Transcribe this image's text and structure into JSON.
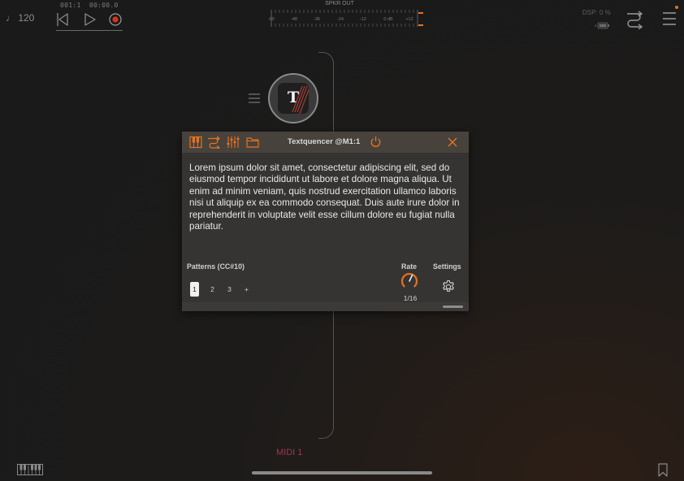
{
  "topbar": {
    "tempo": "♩ 120",
    "position": "001:1",
    "time": "00:00.0",
    "meter_title": "SPKR OUT",
    "meter_scale": [
      "-60",
      "-48",
      "-36",
      "-24",
      "-12",
      "0 dB",
      "+12"
    ],
    "dsp": "DSP: 0 %"
  },
  "chain": {
    "node_letter": "T",
    "midi_label": "MIDI 1"
  },
  "plugin": {
    "title": "Textquencer @M1:1",
    "text": "Lorem ipsum dolor sit amet, consectetur adipiscing elit, sed do eiusmod tempor incididunt ut labore et dolore magna aliqua. Ut enim ad minim veniam, quis nostrud exercitation ullamco laboris nisi ut aliquip ex ea commodo consequat. Duis aute irure dolor in reprehenderit in voluptate velit esse cillum dolore eu fugiat nulla pariatur.",
    "patterns_label": "Patterns (CC#10)",
    "patterns": [
      "1",
      "2",
      "3",
      "+"
    ],
    "selected_pattern": "1",
    "rate_label": "Rate",
    "rate_value": "1/16",
    "settings_label": "Settings"
  },
  "colors": {
    "accent": "#e8721c",
    "midi": "#9b3a4a",
    "window_bg": "#353433",
    "header_bg": "#48423c"
  },
  "icons": [
    "rewind-icon",
    "play-icon",
    "record-icon",
    "battery-icon",
    "routing-icon",
    "menu-icon",
    "drag-handle-icon",
    "piano-icon",
    "routing-icon",
    "mixer-icon",
    "folder-icon",
    "power-icon",
    "close-icon",
    "knob-icon",
    "gear-icon",
    "keyboard-icon",
    "bookmark-icon"
  ]
}
